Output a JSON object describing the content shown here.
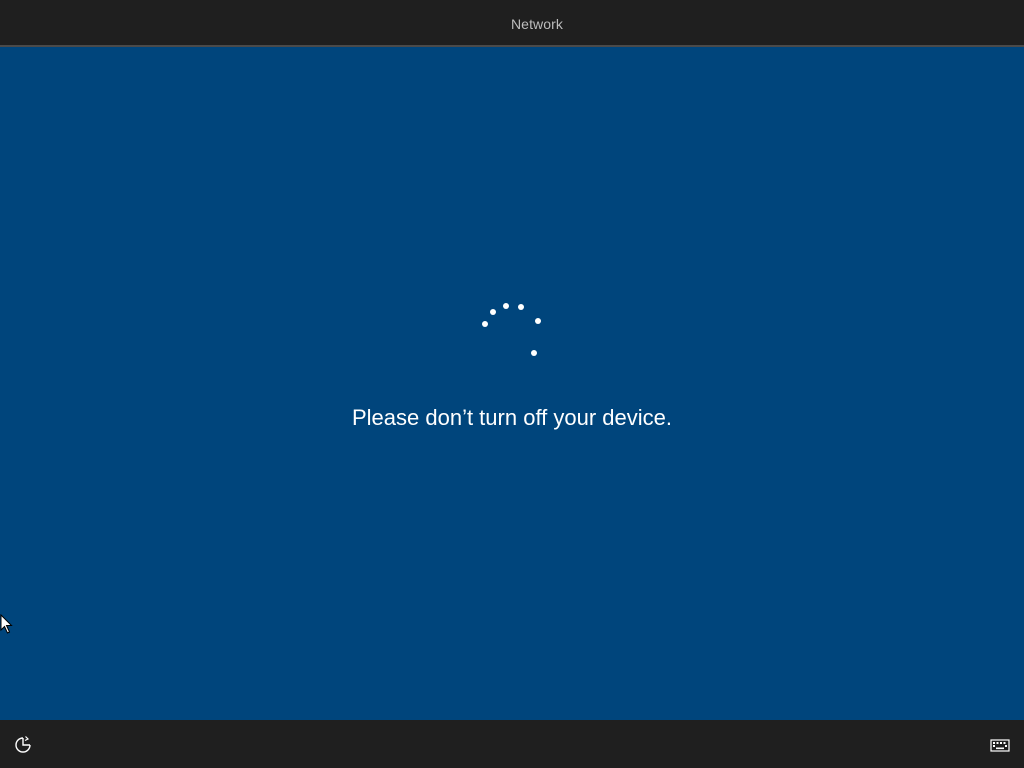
{
  "header": {
    "active_tab": "Network"
  },
  "main": {
    "status_message": "Please don’t turn off your device.",
    "spinner_icon": "loading-spinner-icon",
    "background_color": "#00457c"
  },
  "footer": {
    "left_icon": "ease-of-access-icon",
    "right_icon": "keyboard-icon"
  },
  "colors": {
    "bar_background": "#1f1f1f",
    "accent": "#ffffff",
    "tab_text": "#bdbdbd"
  }
}
